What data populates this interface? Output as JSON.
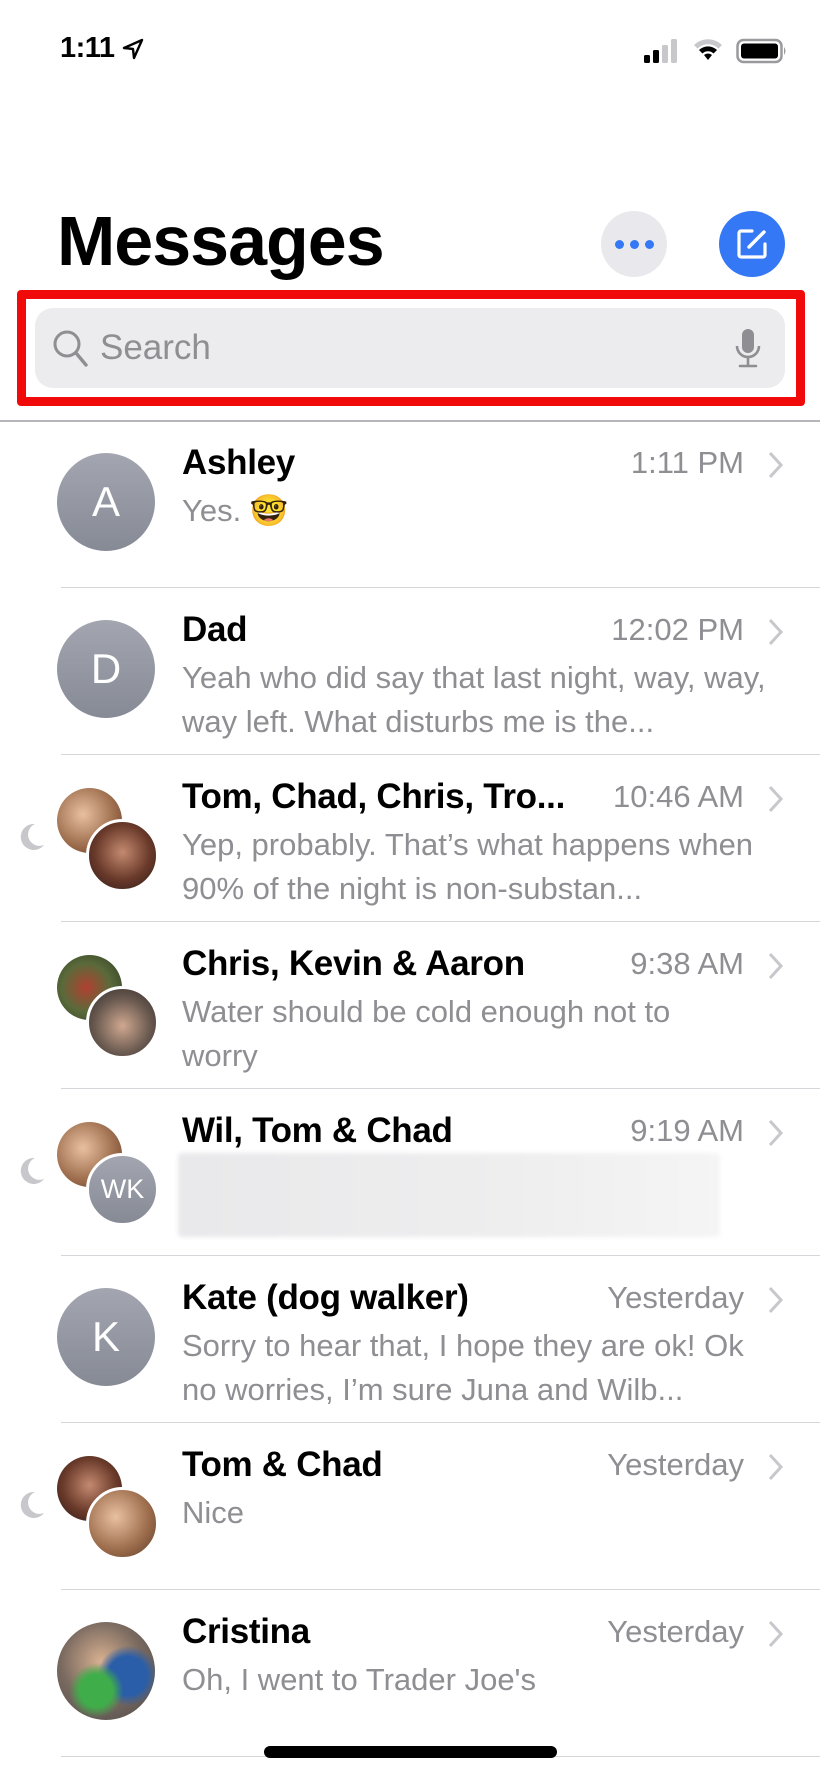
{
  "status_bar": {
    "time": "1:11",
    "location_icon": "location-arrow-icon",
    "signal_bars_filled": 2,
    "signal_bars_total": 4,
    "wifi_bars_filled": 2,
    "wifi_bars_total": 3,
    "battery_level": 0.95
  },
  "header": {
    "title": "Messages",
    "more_icon": "ellipsis-icon",
    "compose_icon": "compose-icon"
  },
  "search": {
    "placeholder": "Search",
    "value": "",
    "search_icon": "magnifier-icon",
    "mic_icon": "microphone-icon"
  },
  "colors": {
    "accent": "#3478f6",
    "highlight": "#f10a0a",
    "secondary_text": "#8e8e93"
  },
  "conversations": [
    {
      "name": "Ashley",
      "time": "1:11 PM",
      "preview": "Yes. 🤓",
      "avatar": {
        "type": "initial",
        "text": "A"
      },
      "muted": false
    },
    {
      "name": "Dad",
      "time": "12:02 PM",
      "preview": "Yeah who did say that last night, way, way, way left. What disturbs me is the...",
      "avatar": {
        "type": "initial",
        "text": "D"
      },
      "muted": false
    },
    {
      "name": "Tom, Chad, Chris, Tro...",
      "time": "10:46 AM",
      "preview": "Yep, probably. That’s what happens when 90% of the night is non-substan...",
      "avatar": {
        "type": "group-photo"
      },
      "muted": true
    },
    {
      "name": "Chris, Kevin & Aaron",
      "time": "9:38 AM",
      "preview": "Water should be cold enough not to worry",
      "avatar": {
        "type": "group-photo"
      },
      "muted": false
    },
    {
      "name": "Wil, Tom & Chad",
      "time": "9:19 AM",
      "preview": "",
      "preview_blurred": true,
      "avatar": {
        "type": "group-photo-initials",
        "text": "WK"
      },
      "muted": true
    },
    {
      "name": "Kate (dog walker)",
      "time": "Yesterday",
      "preview": "Sorry to hear that, I hope they are ok! Ok no worries, I’m sure Juna and Wilb...",
      "avatar": {
        "type": "initial",
        "text": "K"
      },
      "muted": false
    },
    {
      "name": "Tom & Chad",
      "time": "Yesterday",
      "preview": "Nice",
      "avatar": {
        "type": "group-photo"
      },
      "muted": true
    },
    {
      "name": "Cristina",
      "time": "Yesterday",
      "preview": "Oh, I went to Trader Joe's",
      "avatar": {
        "type": "photo"
      },
      "muted": false
    }
  ]
}
